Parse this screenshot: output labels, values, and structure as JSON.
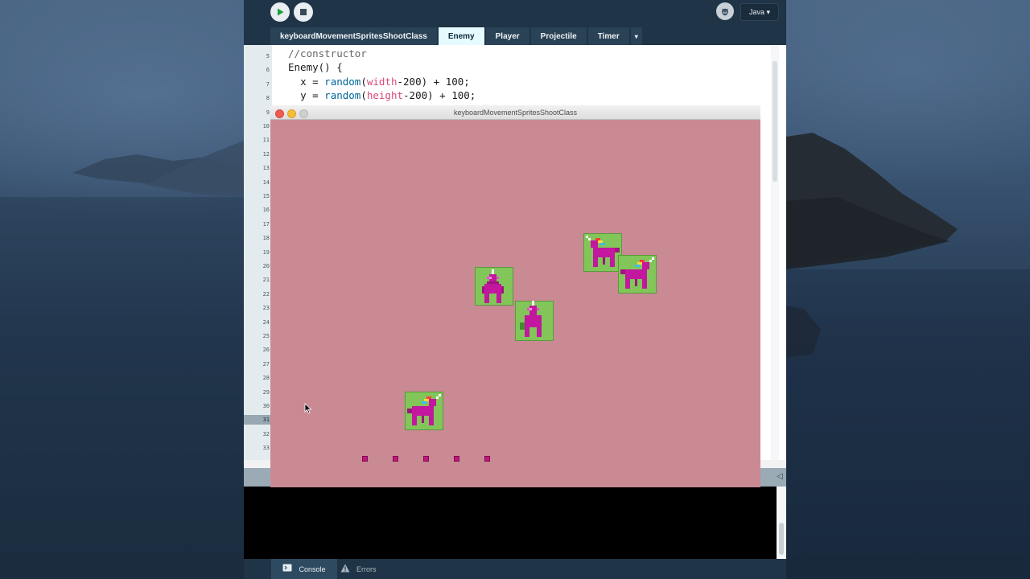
{
  "ide": {
    "toolbar": {
      "run_label": "Run",
      "stop_label": "Stop",
      "mode_label": "Java ▾"
    },
    "tabs": [
      "keyboardMovementSpritesShootClass",
      "Enemy",
      "Player",
      "Projectile",
      "Timer"
    ],
    "active_tab": "Enemy",
    "tab_menu": "▾",
    "line_numbers": [
      "5",
      "6",
      "7",
      "8",
      "9",
      "10",
      "11",
      "12",
      "13",
      "14",
      "15",
      "16",
      "17",
      "18",
      "19",
      "20",
      "21",
      "22",
      "23",
      "24",
      "25",
      "26",
      "27",
      "28",
      "29",
      "30",
      "31",
      "32",
      "33"
    ],
    "current_line": "31",
    "code_lines": [
      {
        "indent": "",
        "parts": [
          {
            "t": "//constructor",
            "c": "cm"
          }
        ]
      },
      {
        "indent": "",
        "parts": [
          {
            "t": "Enemy() {",
            "c": ""
          }
        ]
      },
      {
        "indent": "  ",
        "parts": [
          {
            "t": "x = ",
            "c": ""
          },
          {
            "t": "random",
            "c": "fn"
          },
          {
            "t": "(",
            "c": ""
          },
          {
            "t": "width",
            "c": "vr"
          },
          {
            "t": "-200) + 100;",
            "c": ""
          }
        ]
      },
      {
        "indent": "  ",
        "parts": [
          {
            "t": "y = ",
            "c": ""
          },
          {
            "t": "random",
            "c": "fn"
          },
          {
            "t": "(",
            "c": ""
          },
          {
            "t": "height",
            "c": "vr"
          },
          {
            "t": "-200) + 100;",
            "c": ""
          }
        ]
      }
    ],
    "bottom_tabs": {
      "console": "Console",
      "errors": "Errors"
    }
  },
  "sketch": {
    "title": "keyboardMovementSpritesShootClass",
    "background_color": "#c98a94",
    "sprite_bg_color": "#82c65a",
    "bullet_color": "#c4157e",
    "enemies": [
      {
        "kind": "front-facing",
        "icon": "unicorn-front-icon"
      },
      {
        "kind": "front-facing",
        "icon": "unicorn-front-icon"
      },
      {
        "kind": "side-facing",
        "icon": "unicorn-side-icon"
      },
      {
        "kind": "side-facing",
        "icon": "unicorn-side-icon"
      }
    ],
    "player": {
      "icon": "unicorn-side-icon"
    },
    "projectile_count": 5
  }
}
